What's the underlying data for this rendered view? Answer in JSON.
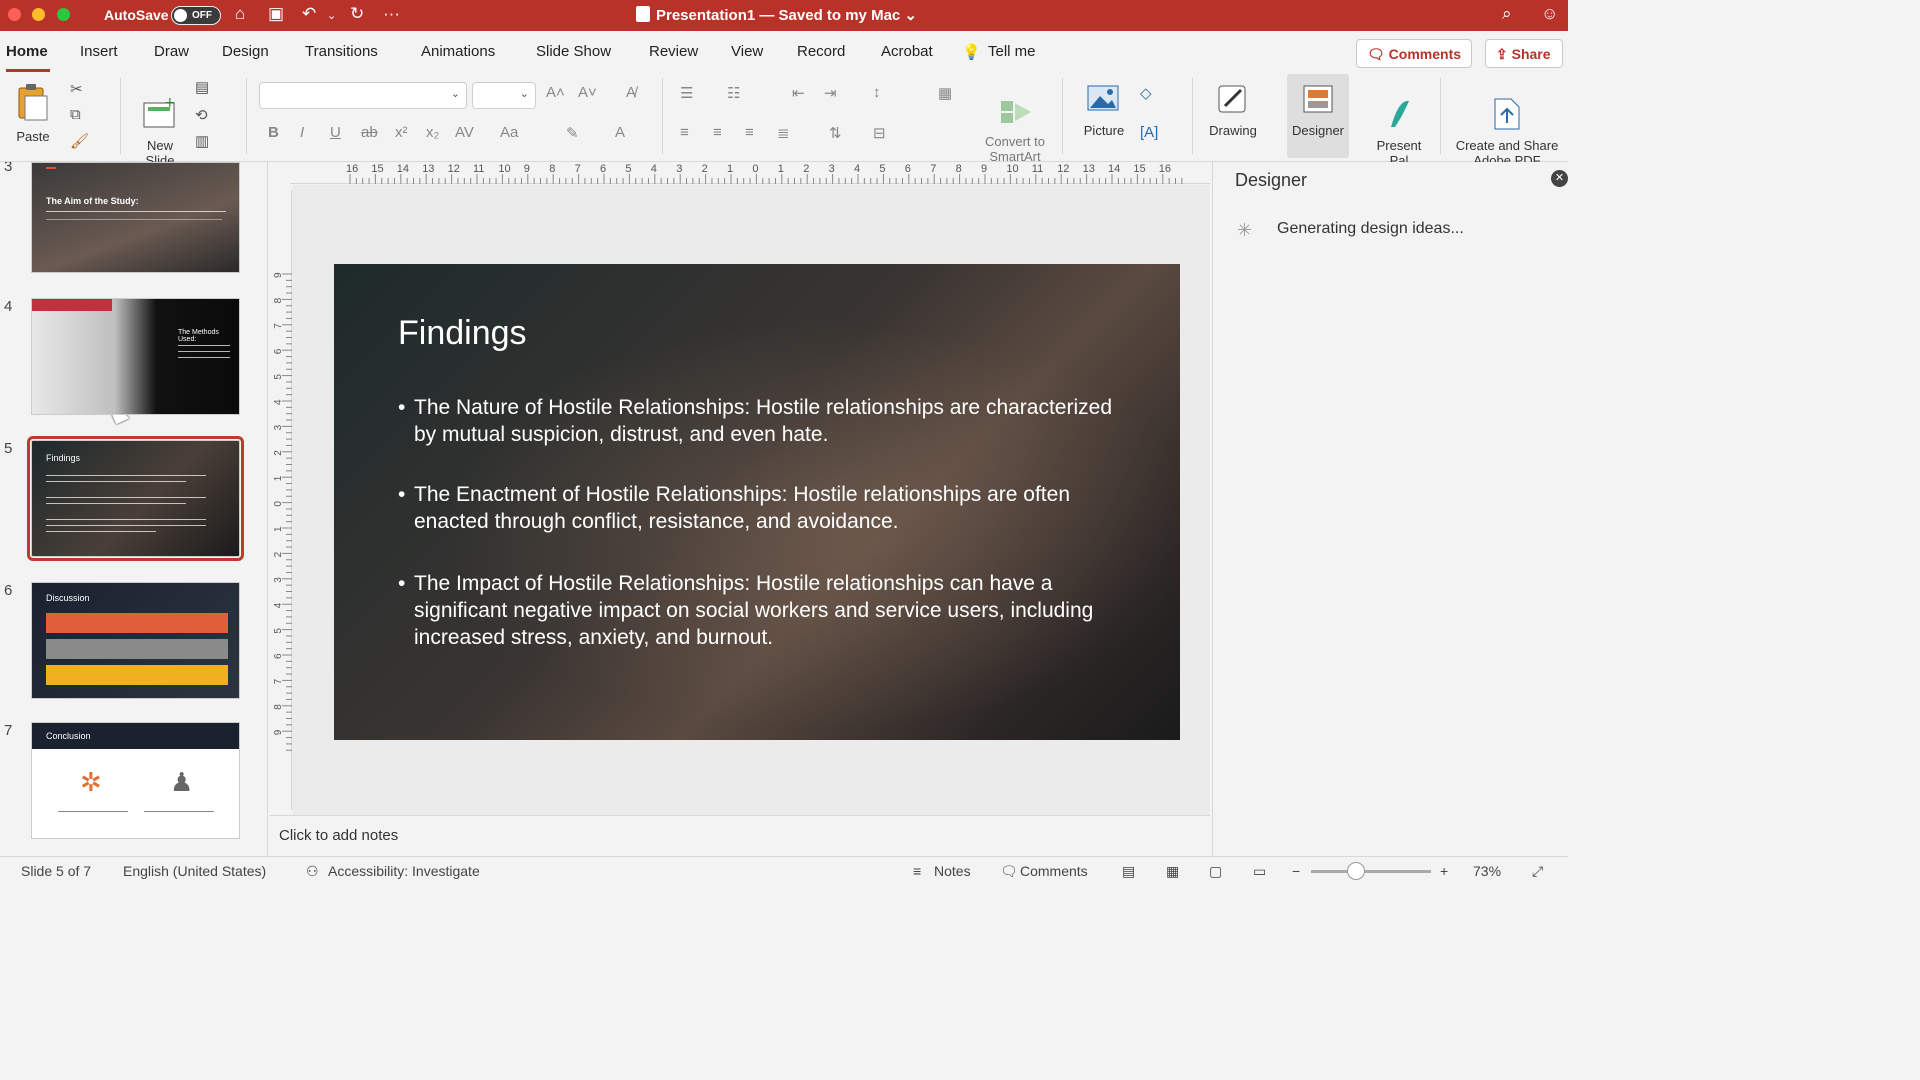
{
  "titlebar": {
    "autosave_label": "AutoSave",
    "autosave_state": "OFF",
    "document_title": "Presentation1 — Saved to my Mac",
    "title_chevron": "⌄",
    "more_icon": "···"
  },
  "tabs": [
    {
      "label": "Home",
      "active": true
    },
    {
      "label": "Insert"
    },
    {
      "label": "Draw"
    },
    {
      "label": "Design"
    },
    {
      "label": "Transitions"
    },
    {
      "label": "Animations"
    },
    {
      "label": "Slide Show"
    },
    {
      "label": "Review"
    },
    {
      "label": "View"
    },
    {
      "label": "Record"
    },
    {
      "label": "Acrobat"
    },
    {
      "label": "Tell me"
    }
  ],
  "actions": {
    "comments": "Comments",
    "share": "Share"
  },
  "ribbon": {
    "paste": "Paste",
    "new_slide": "New\nSlide",
    "convert_smartart": "Convert to\nSmartArt",
    "picture": "Picture",
    "drawing": "Drawing",
    "designer": "Designer",
    "present_pal": "Present\nPal",
    "create_share_pdf": "Create and Share\nAdobe PDF",
    "font_name": "",
    "font_size": ""
  },
  "ruler": {
    "h_ticks": [
      "16",
      "15",
      "14",
      "13",
      "12",
      "11",
      "10",
      "9",
      "8",
      "7",
      "6",
      "5",
      "4",
      "3",
      "2",
      "1",
      "0",
      "1",
      "2",
      "3",
      "4",
      "5",
      "6",
      "7",
      "8",
      "9",
      "10",
      "11",
      "12",
      "13",
      "14",
      "15",
      "16"
    ],
    "v_ticks": [
      "9",
      "8",
      "7",
      "6",
      "5",
      "4",
      "3",
      "2",
      "1",
      "0",
      "1",
      "2",
      "3",
      "4",
      "5",
      "6",
      "7",
      "8",
      "9"
    ]
  },
  "thumbnails": [
    {
      "number": "3",
      "title": "The Aim of the Study:"
    },
    {
      "number": "4",
      "title": "The Methods Used:"
    },
    {
      "number": "5",
      "title": "Findings",
      "selected": true
    },
    {
      "number": "6",
      "title": "Discussion"
    },
    {
      "number": "7",
      "title": "Conclusion"
    }
  ],
  "slide": {
    "title": "Findings",
    "bullets": [
      "The Nature of Hostile Relationships: Hostile relationships are characterized by mutual suspicion, distrust, and even hate.",
      "The Enactment of Hostile Relationships: Hostile relationships are often enacted through conflict, resistance, and avoidance.",
      "The Impact of Hostile Relationships: Hostile relationships can have a significant negative impact on social workers and service users, including increased stress, anxiety, and burnout."
    ]
  },
  "notes": {
    "placeholder": "Click to add notes"
  },
  "designer": {
    "title": "Designer",
    "status": "Generating design ideas..."
  },
  "statusbar": {
    "slide_indicator": "Slide 5 of 7",
    "language": "English (United States)",
    "accessibility": "Accessibility: Investigate",
    "notes": "Notes",
    "comments": "Comments",
    "zoom": "73%"
  },
  "colors": {
    "accent": "#b8322a",
    "selection": "#c0392b"
  }
}
